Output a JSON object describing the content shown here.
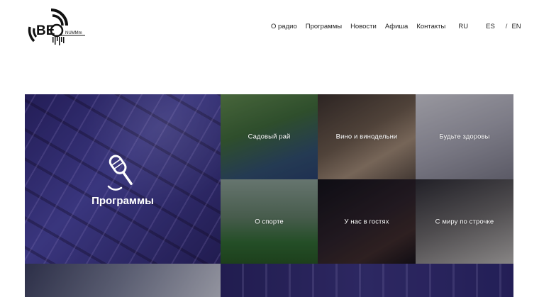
{
  "header": {
    "logo_text": "BEO",
    "logo_subtext": "NUMMm"
  },
  "nav": {
    "items": [
      {
        "label": "О радио"
      },
      {
        "label": "Программы"
      },
      {
        "label": "Новости"
      },
      {
        "label": "Афиша"
      },
      {
        "label": "Контакты"
      }
    ],
    "languages": {
      "ru": "RU",
      "es": "ES",
      "separator": "/",
      "en": "EN"
    }
  },
  "grid": {
    "programs_label": "Программы",
    "tiles": [
      {
        "label": "Садовый рай"
      },
      {
        "label": "Вино и винодельни"
      },
      {
        "label": "Будьте здоровы"
      },
      {
        "label": "О спорте"
      },
      {
        "label": "У нас в гостях"
      },
      {
        "label": "С миру по строчке"
      }
    ]
  },
  "icons": {
    "logo": "radio-waves-logo",
    "programs": "microphone-icon"
  }
}
